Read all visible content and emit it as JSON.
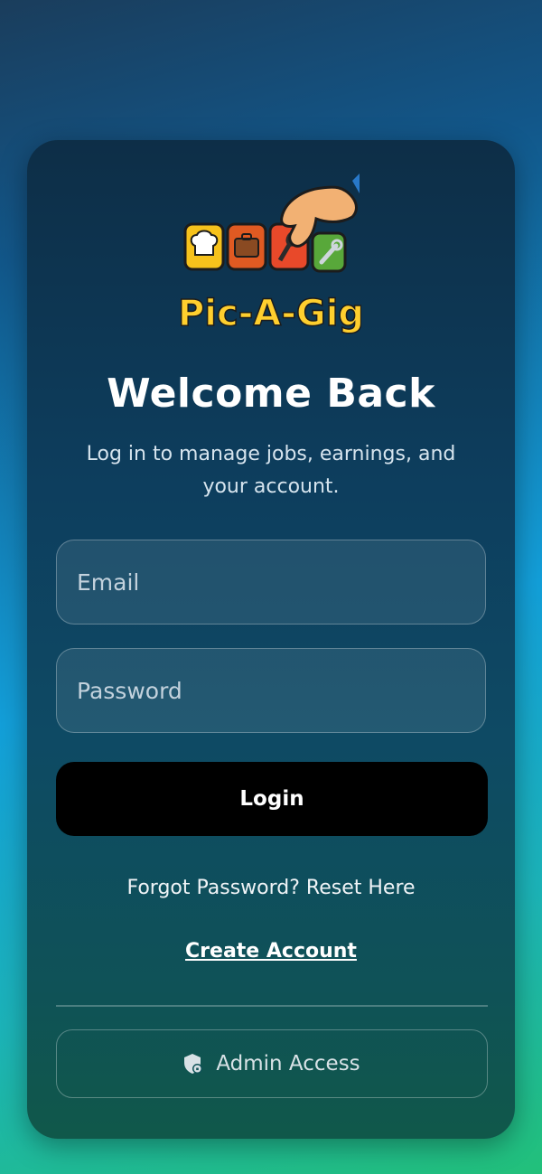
{
  "brand": {
    "logo_text": "Pic-A-Gig",
    "logo_icon": "hand-picking-gig-tiles"
  },
  "login": {
    "title": "Welcome Back",
    "subtitle": "Log in to manage jobs, earnings, and your account.",
    "email_placeholder": "Email",
    "password_placeholder": "Password",
    "login_label": "Login",
    "forgot_label": "Forgot Password? Reset Here",
    "create_account_label": "Create Account",
    "admin_label": "Admin Access",
    "admin_icon": "shield-lock-icon"
  },
  "colors": {
    "primary_button": "#000000",
    "card_top": "#0d2e47",
    "card_bottom": "#10584a",
    "background_top": "#1a3d5c",
    "background_bottom": "#22c07a"
  }
}
